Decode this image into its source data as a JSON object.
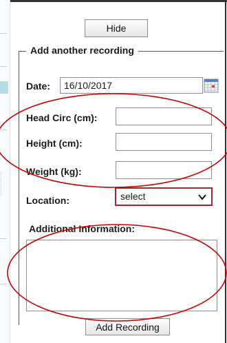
{
  "panel": {
    "hide_label": "Hide",
    "legend": "Add another recording"
  },
  "form": {
    "date_label": "Date:",
    "date_value": "16/10/2017",
    "head_label": "Head Circ (cm):",
    "height_label": "Height (cm):",
    "weight_label": "Weight (kg):",
    "location_label": "Location:",
    "location_value": "select",
    "additional_label": "Additional Information:",
    "submit_label": "Add Recording"
  },
  "colors": {
    "annotation": "#cc0000",
    "select_border": "#9b2a2a"
  },
  "icons": [
    "calendar-icon",
    "chevron-down-icon"
  ]
}
